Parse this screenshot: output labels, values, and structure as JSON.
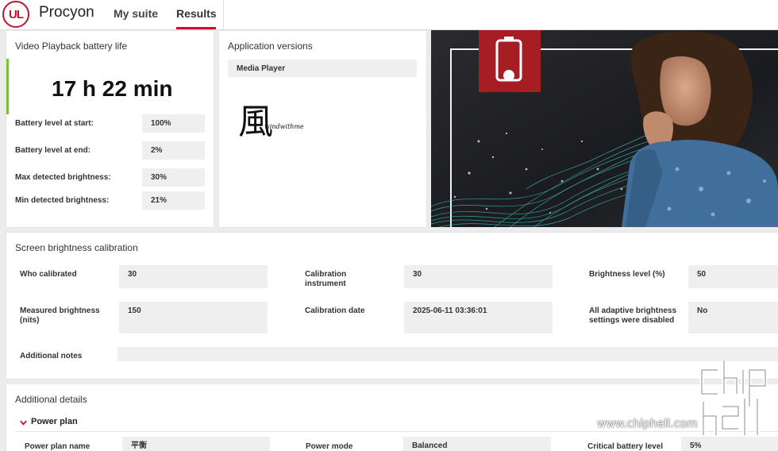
{
  "header": {
    "logo_text": "UL",
    "brand": "Procyon",
    "tabs": [
      {
        "label": "My suite",
        "active": false
      },
      {
        "label": "Results",
        "active": true
      }
    ]
  },
  "battery": {
    "title": "Video Playback battery life",
    "duration": "17 h 22 min",
    "stats": [
      {
        "label": "Battery level at start:",
        "value": "100%"
      },
      {
        "label": "Battery level at end:",
        "value": "2%"
      },
      {
        "label": "Max detected brightness:",
        "value": "30%"
      },
      {
        "label": "Min detected brightness:",
        "value": "21%"
      }
    ]
  },
  "app_versions": {
    "title": "Application versions",
    "items": [
      "Media Player"
    ],
    "signature_glyph": "風",
    "signature_text": "windwithme"
  },
  "hero_image": {
    "icon": "battery-icon",
    "accent_color": "#a61d24"
  },
  "calibration": {
    "title": "Screen brightness calibration",
    "fields": [
      {
        "label": "Who calibrated",
        "value": "30"
      },
      {
        "label": "Calibration instrument",
        "value": "30"
      },
      {
        "label": "Brightness level (%)",
        "value": "50"
      },
      {
        "label": "Measured brightness (nits)",
        "value": "150"
      },
      {
        "label": "Calibration date",
        "value": "2025-06-11 03:36:01"
      },
      {
        "label": "All adaptive brightness settings were disabled",
        "value": "No"
      }
    ],
    "notes_label": "Additional notes",
    "notes_value": ""
  },
  "details": {
    "title": "Additional details",
    "power_plan_heading": "Power plan",
    "fields": [
      {
        "label": "Power plan name",
        "value": "平衡"
      },
      {
        "label": "Power mode",
        "value": "Balanced"
      },
      {
        "label": "Critical battery level",
        "value": "5%"
      }
    ]
  },
  "watermark": {
    "text": "www.chiphell.com",
    "logo_text": "chip hell"
  },
  "colors": {
    "brand_red": "#c8102e",
    "accent_green": "#7ac142",
    "teal_waves": "#3fc6c6"
  }
}
